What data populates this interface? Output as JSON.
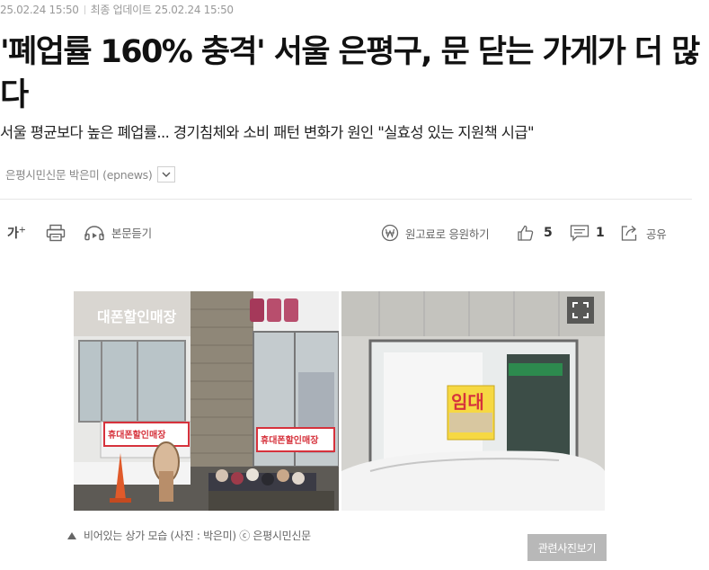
{
  "meta": {
    "published": "25.02.24 15:50",
    "updated_label": "최종 업데이트",
    "updated": "25.02.24 15:50"
  },
  "article": {
    "headline": "'폐업률 160% 충격' 서울 은평구, 문 닫는 가게가 더 많다",
    "subtitle": "서울 평균보다 높은 폐업률... 경기침체와 소비 패턴 변화가 원인 \"실효성 있는 지원책 시급\"",
    "byline": "은평시민신문 박은미 (epnews)"
  },
  "toolbar": {
    "font_size_label": "가",
    "font_size_sup": "+",
    "print_icon": "print-icon",
    "listen_label": "본문듣기",
    "support_label": "원고료로 응원하기",
    "like_count": "5",
    "comment_count": "1",
    "share_label": "공유"
  },
  "photo": {
    "left_sign_text": "대폰할인매장",
    "left_window_sign": "휴대폰할인매장",
    "right_sign_text": "임대",
    "caption": "비어있는 상가 모습 (사진 : 박은미) ⓒ 은평시민신문",
    "related_button": "관련사진보기"
  },
  "colors": {
    "accent_red": "#d6323c",
    "text_dark": "#111111",
    "meta_gray": "#999999"
  }
}
